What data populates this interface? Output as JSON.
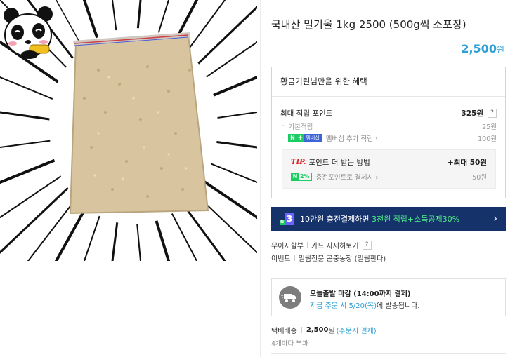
{
  "product": {
    "title": "국내산 밀기울 1kg 2500 (500g씩 소포장)",
    "price": "2,500",
    "price_unit": "원"
  },
  "benefits": {
    "header": "황금기린님만을 위한 혜택",
    "max_points_label": "최대 적립 포인트",
    "max_points_value": "325원",
    "help_mark": "?",
    "basic_label": "기본적립",
    "basic_value": "25원",
    "membership_badge_n": "N",
    "membership_badge_plus": "+",
    "membership_badge_text": "멤버십",
    "membership_label": "멤버십 추가 적립",
    "membership_chevron": "›",
    "membership_value": "100원",
    "tip_label": "TIP.",
    "tip_text": "포인트 더 받는 방법",
    "tip_value": "+최대 50원",
    "charge_badge_n": "N",
    "charge_badge_pct": "2%",
    "charge_label": "충전포인트로 결제시",
    "charge_chevron": "›",
    "charge_value": "50원"
  },
  "banner": {
    "badge_small": "N",
    "badge_number": "3",
    "text_plain": "10만원 충전결제하면 ",
    "text_highlight": "3천원 적립+소득공제30%",
    "arrow": "›"
  },
  "links": {
    "installment": "무이자할부",
    "card_detail": "카드 자세히보기",
    "help_mark": "?",
    "event_label": "이벤트",
    "event_text": "밀웜전문 곤충농장 (밀웜판다)"
  },
  "shipping": {
    "title": "오늘출발 마감 (14:00까지 결제)",
    "notice_highlight": "지금 주문 시 5/20(목)",
    "notice_rest": "에 발송됩니다."
  },
  "delivery": {
    "type": "택배배송",
    "fee": "2,500",
    "won": "원",
    "condition": "(주문시 결제)",
    "bundle": "4개마다 부과"
  },
  "colors": {
    "accent_blue": "#2ea0d6",
    "banner_navy": "#16326a",
    "naver_green": "#19ce60",
    "tip_red": "#e02020"
  },
  "icons": {
    "panda": "panda-mascot-icon",
    "truck": "truck-icon"
  }
}
